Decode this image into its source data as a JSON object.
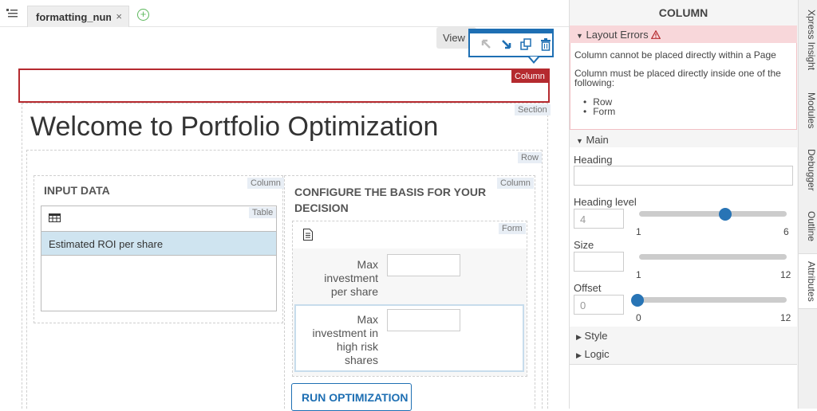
{
  "tabbar": {
    "file_tab_label": "formatting_num",
    "close_glyph": "×",
    "add_glyph": "+"
  },
  "canvas": {
    "view_label": "View",
    "selected_tag": "Column",
    "section_tag": "Section",
    "row_tag": "Row",
    "page_title": "Welcome to Portfolio Optimization",
    "col1": {
      "tag": "Column",
      "heading": "INPUT DATA"
    },
    "table": {
      "tag": "Table",
      "row_text": "Estimated ROI per share"
    },
    "col2": {
      "tag": "Column",
      "heading": "CONFIGURE THE BASIS FOR YOUR DECISION"
    },
    "form": {
      "tag": "Form",
      "field1_label": "Max investment per share",
      "field2_label": "Max investment in high risk shares",
      "run_button": "RUN OPTIMIZATION"
    }
  },
  "panel": {
    "title": "COLUMN",
    "errors": {
      "header": "Layout Errors",
      "line1": "Column cannot be placed directly within a Page",
      "line2": "Column must be placed directly inside one of the following:",
      "items": [
        "Row",
        "Form"
      ]
    },
    "main": {
      "header": "Main",
      "heading_label": "Heading",
      "heading_value": "",
      "heading_level_label": "Heading level",
      "heading_level_value": "4",
      "heading_level_min": "1",
      "heading_level_max": "6",
      "size_label": "Size",
      "size_value": "",
      "size_min": "1",
      "size_max": "12",
      "offset_label": "Offset",
      "offset_value": "0",
      "offset_min": "0",
      "offset_max": "12"
    },
    "style_header": "Style",
    "logic_header": "Logic"
  },
  "sidetabs": [
    "Xpress Insight",
    "Modules",
    "Debugger",
    "Outline",
    "Attributes"
  ],
  "colors": {
    "accent": "#1e6fb3",
    "error": "#b52a2f",
    "error_bg": "#f8d7da",
    "selected_row": "#cfe4f0"
  }
}
